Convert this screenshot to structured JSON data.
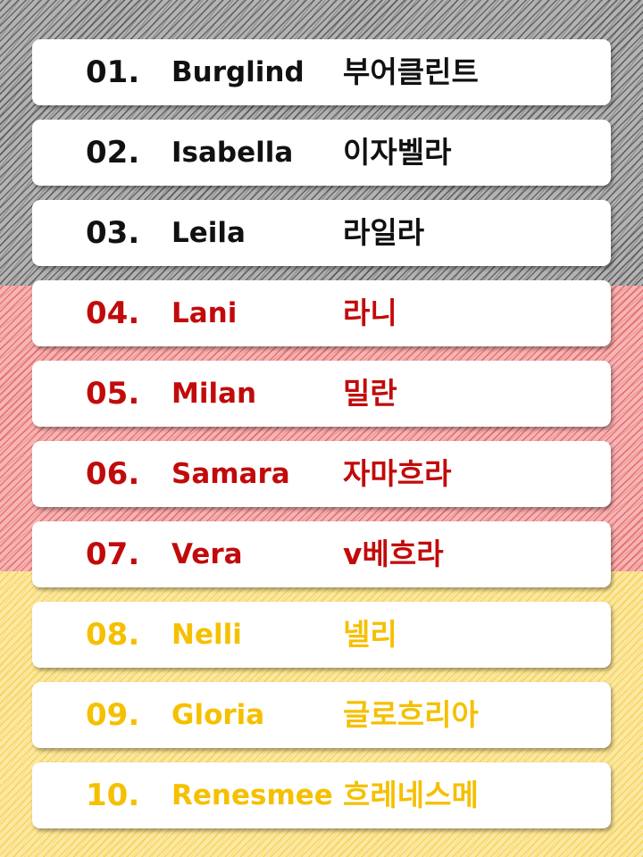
{
  "colors": {
    "black": "#111111",
    "red": "#c10b0b",
    "gold": "#f5c000"
  },
  "names": [
    {
      "num": "01.",
      "name": "Burglind",
      "korean": "부어클린트",
      "color": "black"
    },
    {
      "num": "02.",
      "name": "Isabella",
      "korean": "이자벨라",
      "color": "black"
    },
    {
      "num": "03.",
      "name": "Leila",
      "korean": "라일라",
      "color": "black"
    },
    {
      "num": "04.",
      "name": "Lani",
      "korean": "라니",
      "color": "red"
    },
    {
      "num": "05.",
      "name": "Milan",
      "korean": "밀란",
      "color": "red"
    },
    {
      "num": "06.",
      "name": "Samara",
      "korean": "자마흐라",
      "color": "red"
    },
    {
      "num": "07.",
      "name": "Vera",
      "korean": "v베흐라",
      "color": "red"
    },
    {
      "num": "08.",
      "name": "Nelli",
      "korean": "넬리",
      "color": "gold"
    },
    {
      "num": "09.",
      "name": "Gloria",
      "korean": "글로흐리아",
      "color": "gold"
    },
    {
      "num": "10.",
      "name": "Renesmee",
      "korean": "흐레네스메",
      "color": "gold"
    }
  ]
}
